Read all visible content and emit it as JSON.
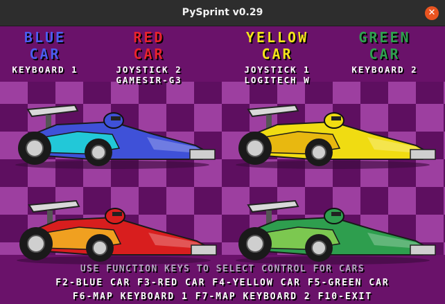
{
  "window": {
    "title": "PySprint v0.29",
    "close_glyph": "✕"
  },
  "cars": [
    {
      "id": "blue",
      "name_line1": "BLUE",
      "name_line2": "CAR",
      "control_line1": "KEYBOARD 1",
      "control_line2": "",
      "color": "#3f51d8",
      "label_color": "#4c5cf0",
      "accent": "#22c8d8"
    },
    {
      "id": "red",
      "name_line1": "RED",
      "name_line2": "CAR",
      "control_line1": "JOYSTICK 2",
      "control_line2": "GAMESIR-G3",
      "color": "#d81e1e",
      "label_color": "#e8232e",
      "accent": "#f0a020"
    },
    {
      "id": "yellow",
      "name_line1": "YELLOW",
      "name_line2": "CAR",
      "control_line1": "JOYSTICK 1",
      "control_line2": "LOGITECH W",
      "color": "#f0dc12",
      "label_color": "#f4e21c",
      "accent": "#e8b810"
    },
    {
      "id": "green",
      "name_line1": "GREEN",
      "name_line2": "CAR",
      "control_line1": "KEYBOARD 2",
      "control_line2": "",
      "color": "#2e9e4e",
      "label_color": "#2fa04f",
      "accent": "#7cc850"
    }
  ],
  "footer": {
    "instruction": "USE FUNCTION KEYS TO SELECT CONTROL FOR CARS",
    "line1": "F2-BLUE CAR  F3-RED CAR  F4-YELLOW CAR  F5-GREEN CAR",
    "line2": "F6-MAP KEYBOARD 1  F7-MAP KEYBOARD 2  F10-EXIT"
  },
  "colors": {
    "background": "#6a126a",
    "checker_light": "#9d3fa0",
    "checker_dark": "#5e0f60",
    "titlebar": "#2d2d2d",
    "close_button": "#e95420"
  }
}
